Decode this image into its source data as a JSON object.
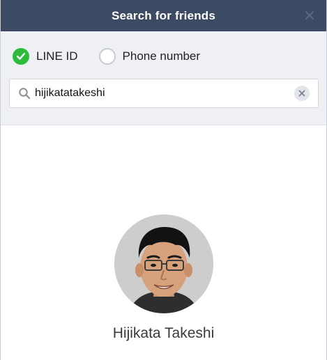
{
  "window": {
    "title": "Search for friends"
  },
  "search_options": {
    "options": [
      {
        "label": "LINE ID",
        "selected": true
      },
      {
        "label": "Phone number",
        "selected": false
      }
    ]
  },
  "search": {
    "value": "hijikatatakeshi"
  },
  "result": {
    "name": "Hijikata Takeshi"
  },
  "colors": {
    "titlebar": "#3d4a63",
    "panel": "#eef0f3",
    "accent_green": "#2dbb3d"
  },
  "icons": {
    "close": "close-icon",
    "checked": "check-icon",
    "search": "search-icon",
    "clear": "clear-icon"
  }
}
